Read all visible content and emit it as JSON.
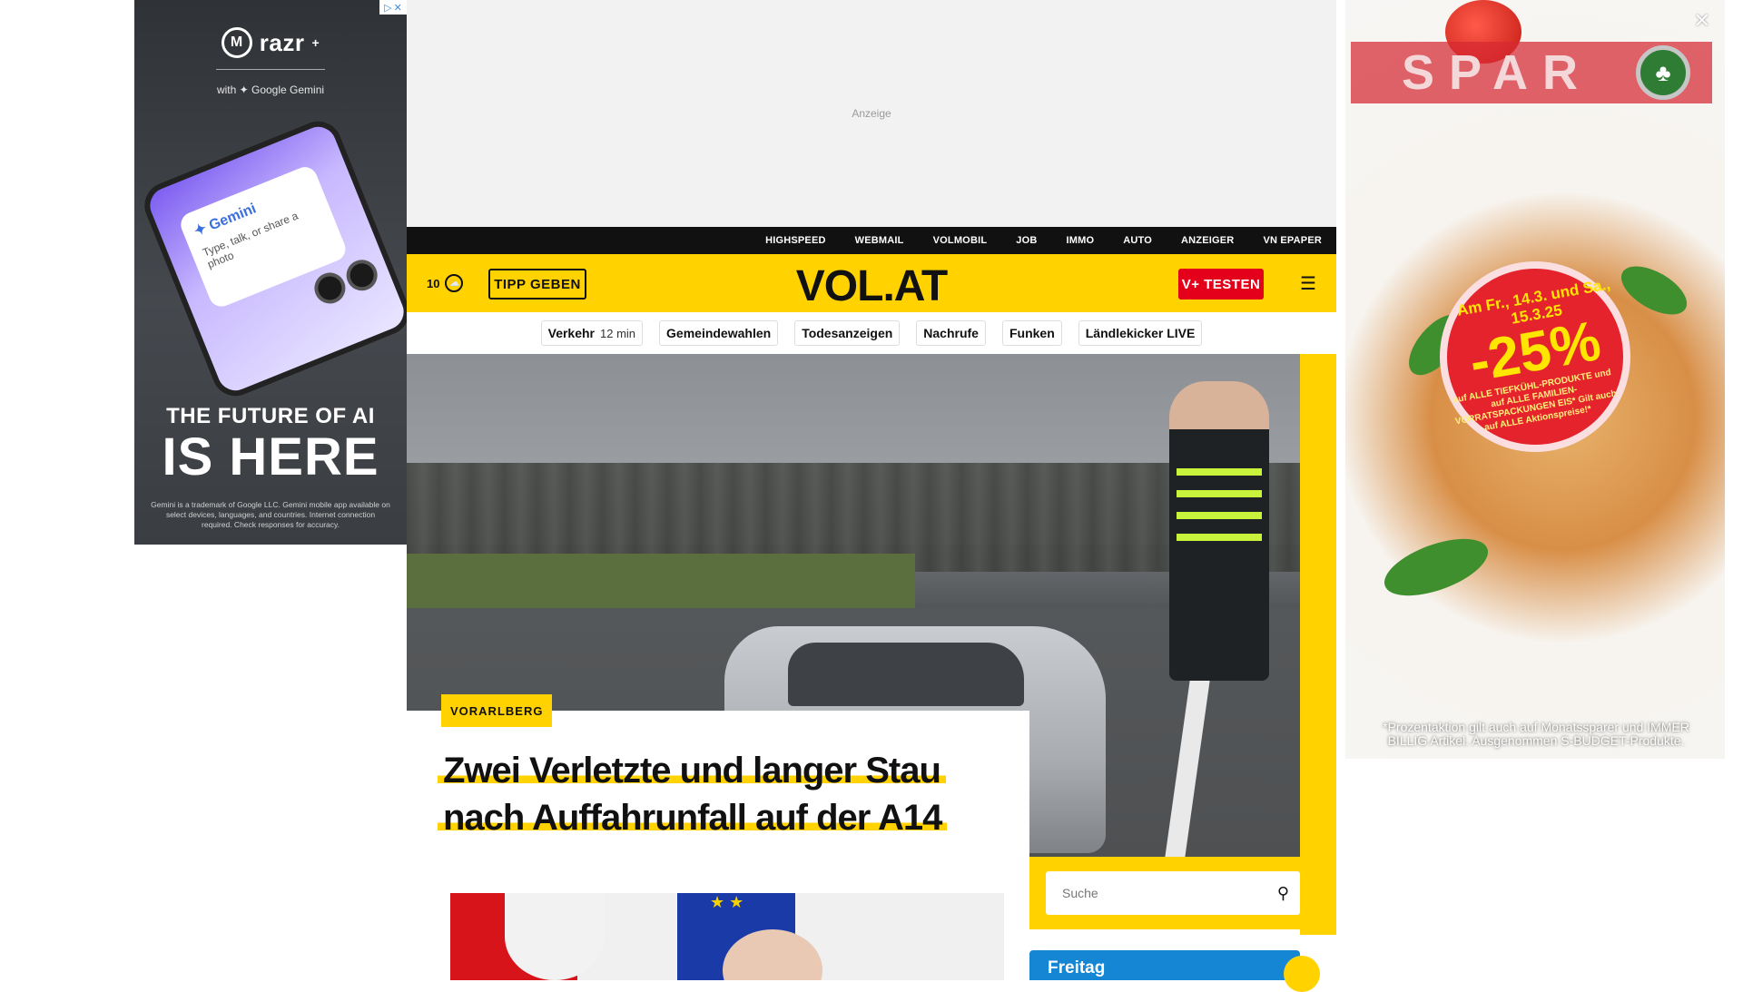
{
  "ads": {
    "left": {
      "brand": "razr",
      "brand_sup": "+",
      "with_text": "with ✦ Google Gemini",
      "phone_prompt_title": "✦ Gemini",
      "phone_prompt": "Type, talk, or share a photo",
      "headline_1": "THE FUTURE OF AI",
      "headline_2": "IS HERE",
      "disclaimer": "Gemini is a trademark of Google LLC. Gemini mobile app available on select devices, languages, and countries. Internet connection required. Check responses for accuracy."
    },
    "top": {
      "label": "Anzeige"
    },
    "right": {
      "brand": "SPAR",
      "badge_date": "Am Fr., 14.3. und Sa., 15.3.25",
      "badge_percent": "-25%",
      "badge_text": "auf ALLE TIEFKÜHL-PRODUKTE und auf ALLE FAMILIEN- VORRATSPACKUNGEN EIS* Gilt auch auf ALLE Aktionspreise!*",
      "fine_print": "*Prozentaktion gilt auch auf Monatssparer und IMMER BILLIG Artikel. Ausgenommen S-BUDGET-Produkte."
    }
  },
  "topnav": {
    "items": [
      "HIGHSPEED",
      "WEBMAIL",
      "VOLMOBIL",
      "JOB",
      "IMMO",
      "AUTO",
      "ANZEIGER",
      "VN EPAPER"
    ]
  },
  "header": {
    "temperature": "10",
    "weather_icon": "cloud-sun-icon",
    "tipp_label": "TIPP GEBEN",
    "logo": "VOL.AT",
    "vplus_label": "V+ TESTEN",
    "menu_icon": "menu-search-icon"
  },
  "quicklinks": [
    {
      "label": "Verkehr",
      "meta": "12 min"
    },
    {
      "label": "Gemeindewahlen"
    },
    {
      "label": "Todesanzeigen"
    },
    {
      "label": "Nachrufe"
    },
    {
      "label": "Funken"
    },
    {
      "label": "Ländlekicker LIVE"
    }
  ],
  "article": {
    "kicker": "VORARLBERG",
    "headline_line1": "Zwei Verletzte und langer Stau",
    "headline_line2": "nach Auffahrunfall auf der A14"
  },
  "sidebar": {
    "search_placeholder": "Suche",
    "date_label": "Freitag"
  },
  "colors": {
    "brand_yellow": "#ffd200",
    "vplus_red": "#e4001b",
    "nav_black": "#111111",
    "date_blue": "#1486d3"
  }
}
